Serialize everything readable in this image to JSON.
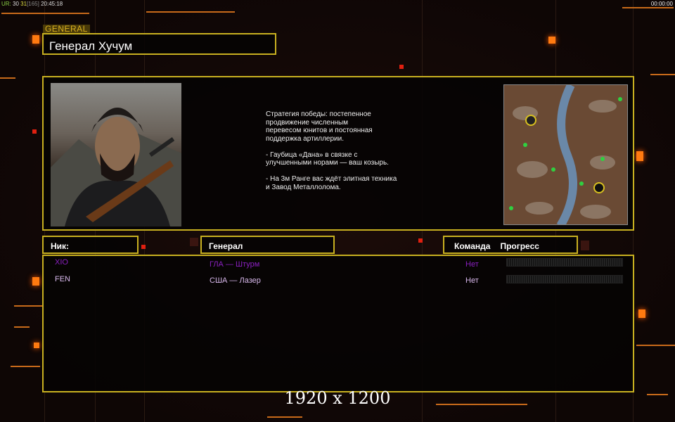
{
  "hud": {
    "ur_label": "UR:",
    "fps1": "30",
    "fps2": "31",
    "bracket": "[165]",
    "time": "20:45:18",
    "clock": "00:00:00"
  },
  "general_tag": "GENERAL",
  "general_name": "Генерал Хучум",
  "description": "Стратегия победы: постепенное\nпродвижение численным\nперевесом юнитов и постоянная\nподдержка артиллерии.\n\n- Гаубица «Дана» в связке с\nулучшенными норами — ваш козырь.\n\n- На 3м Ранге вас ждёт элитная техника\nи Завод Металлолома.",
  "headers": {
    "nick": "Ник:",
    "general": "Генерал",
    "team": "Команда",
    "progress": "Прогресс"
  },
  "players": [
    {
      "nick": "XIO",
      "general": "ГЛА — Штурм",
      "team": "Нет",
      "progress": 0,
      "color": "#8a20c0"
    },
    {
      "nick": "FEN",
      "general": "США — Лазер",
      "team": "Нет",
      "progress": 0,
      "color": "#d8b8ec"
    }
  ],
  "resolution": "1920 x 1200",
  "colors": {
    "frame": "#c8b020",
    "accent": "#ff7a10"
  }
}
